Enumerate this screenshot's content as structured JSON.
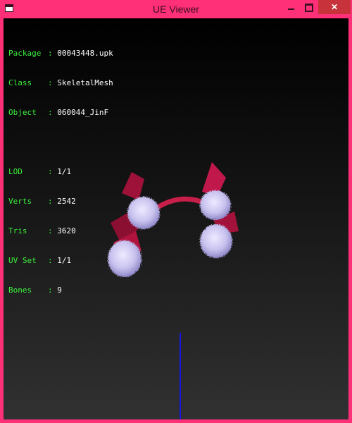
{
  "window": {
    "title": "UE Viewer",
    "icon": "app-icon",
    "controls": {
      "minimize_icon": "minimize-icon",
      "maximize_icon": "maximize-icon",
      "close_glyph": "✕"
    }
  },
  "info": {
    "package": {
      "label": "Package",
      "value": "00043448.upk"
    },
    "class": {
      "label": "Class",
      "value": "SkeletalMesh"
    },
    "object": {
      "label": "Object",
      "value": "060044_JinF"
    },
    "lod": {
      "label": "LOD",
      "value": "1/1"
    },
    "verts": {
      "label": "Verts",
      "value": "2542"
    },
    "tris": {
      "label": "Tris",
      "value": "3620"
    },
    "uvset": {
      "label": "UV Set",
      "value": "1/1"
    },
    "bones": {
      "label": "Bones",
      "value": "9"
    }
  },
  "colors": {
    "frame": "#ff2f78",
    "label_text": "#3cf03c",
    "value_text": "#ffffff",
    "mesh_red": "#b0133e",
    "mesh_fur": "#c8c3f0",
    "axis": "#1a1aff"
  }
}
